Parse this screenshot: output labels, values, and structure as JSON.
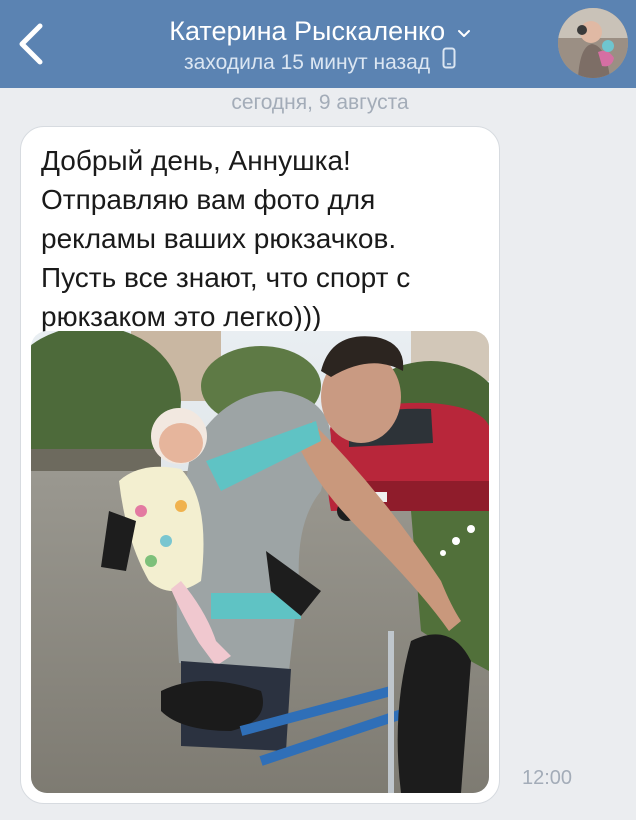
{
  "header": {
    "contact_name": "Катерина Рыскаленко",
    "status": "заходила 15 минут назад",
    "back_icon": "chevron-left-icon",
    "dropdown_icon": "chevron-down-icon",
    "device_icon": "phone-icon",
    "background_color": "#5b83b2"
  },
  "chat": {
    "date_separator": "сегодня, 9 августа",
    "message": {
      "text": "Добрый день, Аннушка!\nОтправляю вам фото для\nрекламы ваших рюкзачков.\nПусть все знают, что спорт с\nрюкзаком это легко)))",
      "time": "12:00"
    }
  },
  "colors": {
    "background": "#ebedf0",
    "bubble": "#ffffff",
    "muted_text": "#a3acb8"
  }
}
